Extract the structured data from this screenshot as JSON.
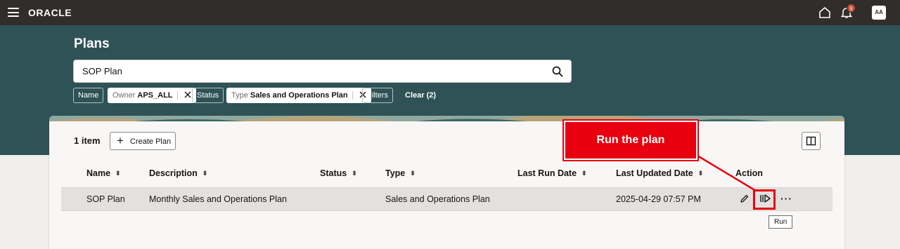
{
  "header": {
    "logo": "ORACLE",
    "notification_count": "9",
    "avatar_initials": "AA"
  },
  "page": {
    "title": "Plans"
  },
  "search": {
    "value": "SOP Plan"
  },
  "filters": {
    "name_label": "Name",
    "owner_key": "Owner",
    "owner_value": "APS_ALL",
    "status_label": "Status",
    "type_key": "Type",
    "type_value": "Sales and Operations Plan",
    "filters_label": "Filters",
    "clear_label": "Clear (2)"
  },
  "toolbar": {
    "item_count": "1 item",
    "create_label": "Create Plan"
  },
  "table": {
    "columns": [
      "Name",
      "Description",
      "Status",
      "Type",
      "Last Run Date",
      "Last Updated Date",
      "Action"
    ],
    "rows": [
      {
        "name": "SOP Plan",
        "description": "Monthly Sales and Operations Plan",
        "status": "",
        "type": "Sales and Operations Plan",
        "last_run_date": "",
        "last_updated_date": "2025-04-29 07:57 PM"
      }
    ]
  },
  "tooltip": {
    "text": "Run"
  },
  "callout": {
    "text": "Run the plan",
    "color": "#e8000f"
  }
}
